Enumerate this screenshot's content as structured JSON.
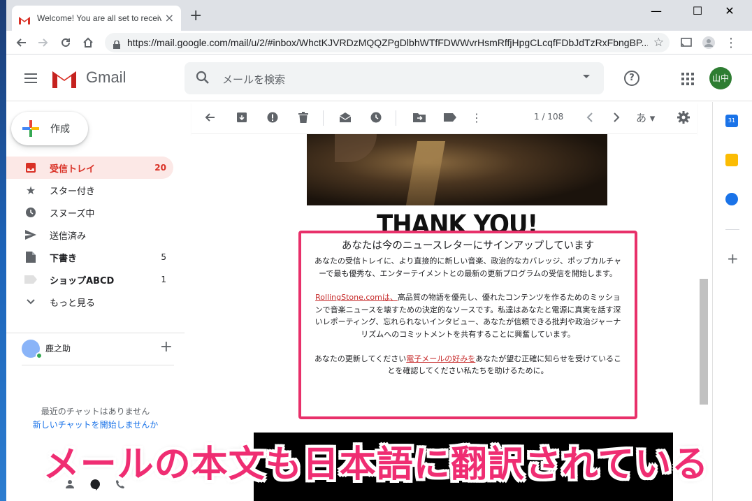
{
  "browser": {
    "tab_title": "Welcome! You are all set to receive",
    "url": "https://mail.google.com/mail/u/2/#inbox/WhctKJVRDzMQQZPgDlbhWTfFDWWvrHsmRffjHpgCLcqfFDbJdTzRxFbngBP...",
    "new_tab": "+",
    "minimize": "—",
    "maximize": "☐",
    "close": "✕"
  },
  "gmail": {
    "brand": "Gmail",
    "search_placeholder": "メールを検索",
    "user_avatar": "山中",
    "compose_label": "作成",
    "nav": [
      {
        "label": "受信トレイ",
        "count": "20",
        "icon": "inbox-icon"
      },
      {
        "label": "スター付き",
        "count": "",
        "icon": "star-icon"
      },
      {
        "label": "スヌーズ中",
        "count": "",
        "icon": "clock-icon"
      },
      {
        "label": "送信済み",
        "count": "",
        "icon": "send-icon"
      },
      {
        "label": "下書き",
        "count": "5",
        "icon": "draft-icon"
      },
      {
        "label": "ショップABCD",
        "count": "1",
        "icon": "label-icon"
      },
      {
        "label": "もっと見る",
        "count": "",
        "icon": "chevron-down-icon"
      }
    ],
    "chat_user": "鹿之助",
    "no_chats": "最近のチャットはありません",
    "start_chat": "新しいチャットを開始しませんか",
    "pagination": "1 / 108",
    "lang_button": "あ"
  },
  "email": {
    "thanks": "THANK YOU!",
    "heading": "あなたは今のニュースレターにサインアップしています",
    "para1": "あなたの受信トレイに、より直接的に新しい音楽、政治的なカバレッジ、ポップカルチャーで最も優秀な、エンターテイメントとの最新の更新プログラムの受信を開始します。",
    "link1": "RollingStone.comは、",
    "para2": "高品質の物語を優先し、優れたコンテンツを作るためのミッションで音楽ニュースを壊すための決定的なソースです。私達はあなたと電源に真実を話す深いレポーティング、忘れられないインタビュー、あなたが信頼できる批判や政治ジャーナリズムへのコミットメントを共有することに興奮しています。",
    "para3_before": "あなたの更新してください",
    "link2": "電子メールの好みを",
    "para3_after": "あなたが望む正確に知らせを受けていることを確認してください私たちを助けるために。"
  },
  "caption": "メールの本文も日本語に翻訳されている"
}
